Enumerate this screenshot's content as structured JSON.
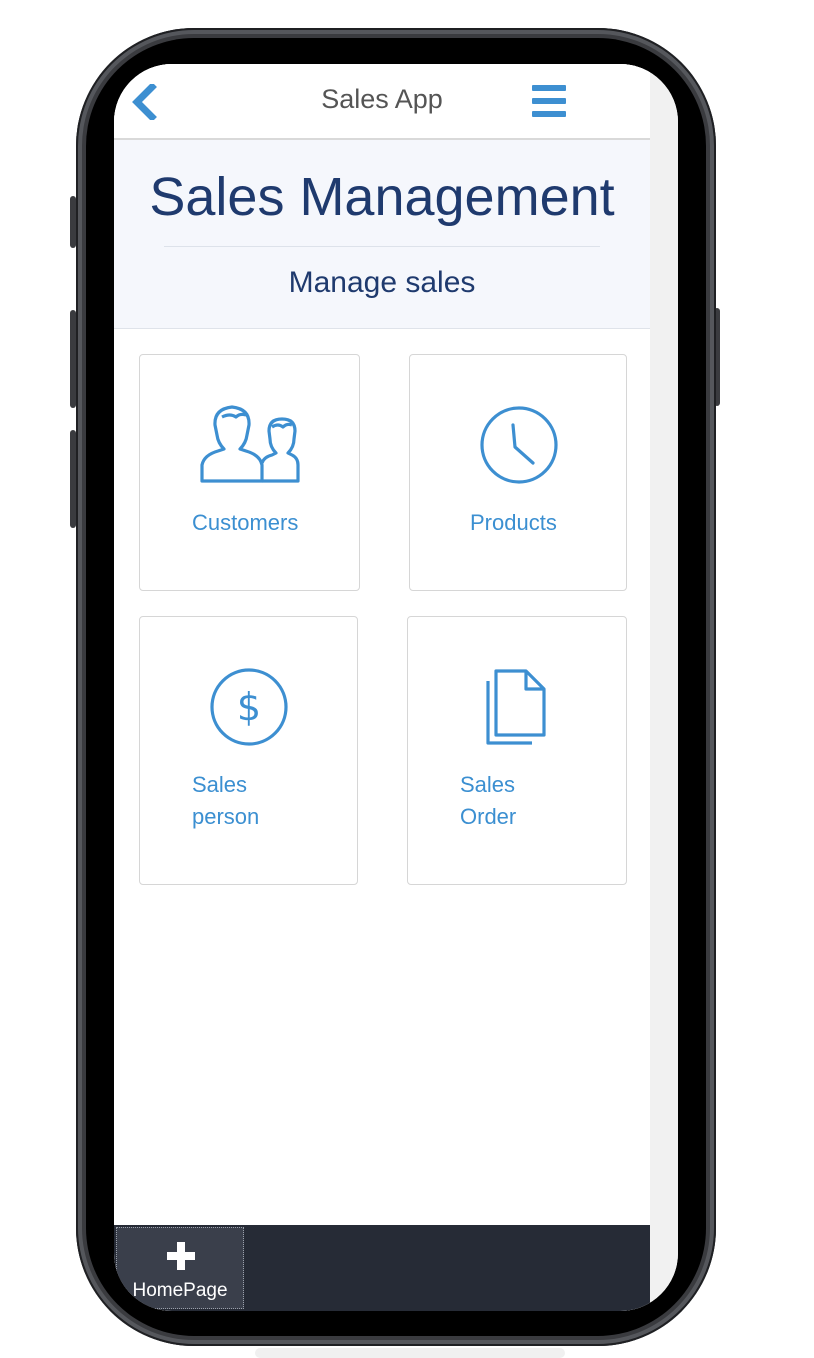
{
  "header": {
    "title": "Sales App",
    "back_icon": "chevron-left-icon",
    "menu_icon": "hamburger-menu-icon"
  },
  "hero": {
    "title": "Sales Management",
    "subtitle": "Manage sales"
  },
  "tiles": [
    {
      "label": "Customers",
      "icon": "users-icon"
    },
    {
      "label": "Products",
      "icon": "clock-icon"
    },
    {
      "label_lines": [
        "Sales",
        "person"
      ],
      "icon": "dollar-circle-icon"
    },
    {
      "label_lines": [
        "Sales",
        "Order"
      ],
      "icon": "documents-icon"
    }
  ],
  "tabbar": {
    "tabs": [
      {
        "label": "HomePage",
        "icon": "plus-icon"
      }
    ]
  },
  "colors": {
    "accent": "#3d8fd1",
    "heading": "#1f3a6e",
    "tabbar": "#262b36"
  }
}
